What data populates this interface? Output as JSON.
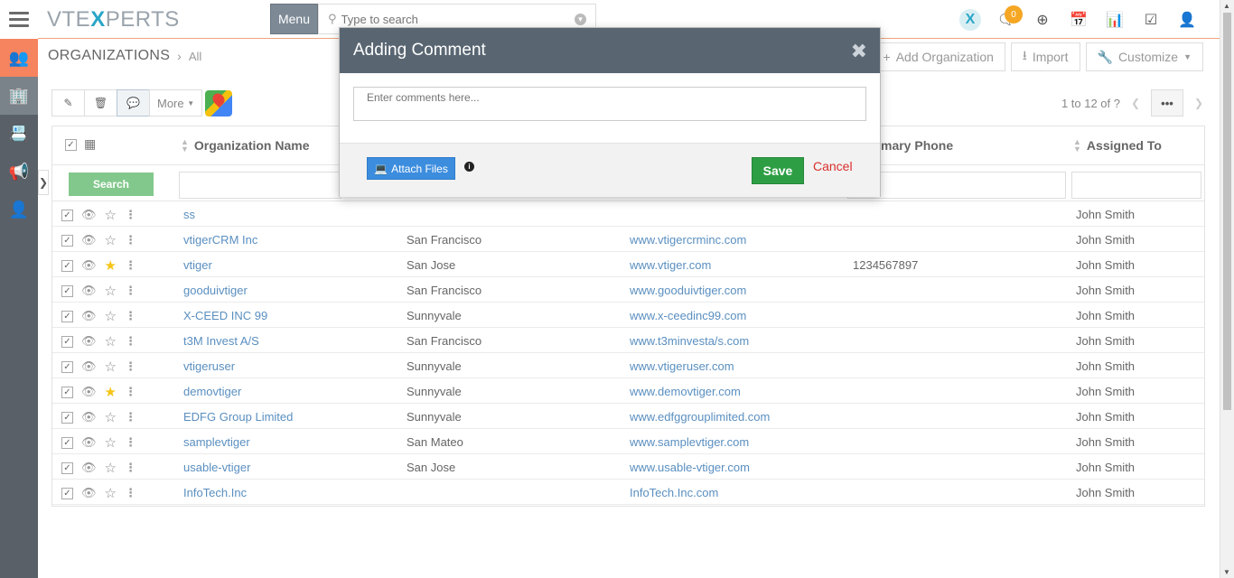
{
  "header": {
    "logo_prefix": "VTE",
    "logo_x": "X",
    "logo_suffix": "PERTS",
    "menu_label": "Menu",
    "search_placeholder": "Type to search",
    "notification_count": "0"
  },
  "page": {
    "title": "ORGANIZATIONS",
    "sub": "All",
    "buttons": {
      "add": "Add Organization",
      "import": "Import",
      "customize": "Customize"
    }
  },
  "toolbar": {
    "more_label": "More",
    "pager_text": "1 to 12  of ?",
    "pager_dots": "•••"
  },
  "table": {
    "columns": {
      "name": "Organization Name",
      "phone": "mary Phone",
      "assigned": "Assigned To"
    },
    "search_label": "Search",
    "rows": [
      {
        "name": "ss",
        "city": "",
        "website": "",
        "phone": "",
        "assigned": "John Smith",
        "starred": false
      },
      {
        "name": "vtigerCRM Inc",
        "city": "San Francisco",
        "website": "www.vtigercrminc.com",
        "phone": "",
        "assigned": "John Smith",
        "starred": false
      },
      {
        "name": "vtiger",
        "city": "San Jose",
        "website": "www.vtiger.com",
        "phone": "1234567897",
        "assigned": "John Smith",
        "starred": true
      },
      {
        "name": "gooduivtiger",
        "city": "San Francisco",
        "website": "www.gooduivtiger.com",
        "phone": "",
        "assigned": "John Smith",
        "starred": false
      },
      {
        "name": "X-CEED INC 99",
        "city": "Sunnyvale",
        "website": "www.x-ceedinc99.com",
        "phone": "",
        "assigned": "John Smith",
        "starred": false
      },
      {
        "name": "t3M Invest A/S",
        "city": "San Francisco",
        "website": "www.t3minvesta/s.com",
        "phone": "",
        "assigned": "John Smith",
        "starred": false
      },
      {
        "name": "vtigeruser",
        "city": "Sunnyvale",
        "website": "www.vtigeruser.com",
        "phone": "",
        "assigned": "John Smith",
        "starred": false
      },
      {
        "name": "demovtiger",
        "city": "Sunnyvale",
        "website": "www.demovtiger.com",
        "phone": "",
        "assigned": "John Smith",
        "starred": true
      },
      {
        "name": "EDFG Group Limited",
        "city": "Sunnyvale",
        "website": "www.edfggrouplimited.com",
        "phone": "",
        "assigned": "John Smith",
        "starred": false
      },
      {
        "name": "samplevtiger",
        "city": "San Mateo",
        "website": "www.samplevtiger.com",
        "phone": "",
        "assigned": "John Smith",
        "starred": false
      },
      {
        "name": "usable-vtiger",
        "city": "San Jose",
        "website": "www.usable-vtiger.com",
        "phone": "",
        "assigned": "John Smith",
        "starred": false
      },
      {
        "name": "InfoTech.Inc",
        "city": "",
        "website": "InfoTech.Inc.com",
        "phone": "",
        "assigned": "John Smith",
        "starred": false
      }
    ]
  },
  "modal": {
    "title": "Adding Comment",
    "placeholder": "Enter comments here...",
    "attach_label": "Attach Files",
    "save_label": "Save",
    "cancel_label": "Cancel"
  },
  "colors": {
    "accent_orange": "#f5845f",
    "sidebar_bg": "#596068",
    "link_blue": "#5a8fc0",
    "save_green": "#2e9e45",
    "cancel_red": "#d9302c",
    "modal_header": "#596672"
  }
}
